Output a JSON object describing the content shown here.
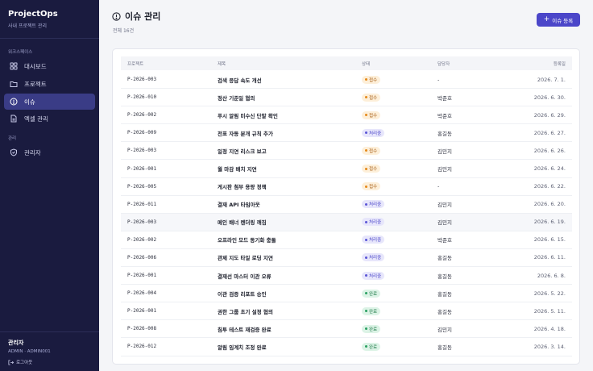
{
  "sidebar": {
    "brand": "ProjectOps",
    "brand_sub": "사내 프로젝트 관리",
    "workspace_label": "워크스페이스",
    "admin_label": "관리",
    "items": [
      {
        "label": "대시보드",
        "icon": "dashboard-icon"
      },
      {
        "label": "프로젝트",
        "icon": "folder-icon"
      },
      {
        "label": "이슈",
        "icon": "alert-circle-icon",
        "active": true
      },
      {
        "label": "엑셀 관리",
        "icon": "file-icon"
      },
      {
        "label": "관리자",
        "icon": "shield-icon"
      }
    ],
    "user": {
      "name": "관리자",
      "role": "ADMIN · ADMIN001",
      "logout": "로그아웃"
    }
  },
  "header": {
    "title": "이슈 관리",
    "count": "전체 16건",
    "add_button": "이슈 등록"
  },
  "table": {
    "columns": {
      "project": "프로젝트",
      "title": "제목",
      "status": "상태",
      "owner": "담당자",
      "date": "등록일"
    },
    "rows": [
      {
        "project": "P-2026-003",
        "title": "검색 응답 속도 개선",
        "status": "접수",
        "status_kind": "received",
        "owner": "-",
        "date": "2026. 7. 1."
      },
      {
        "project": "P-2026-010",
        "title": "정산 기준일 협의",
        "status": "접수",
        "status_kind": "received",
        "owner": "박준호",
        "date": "2026. 6. 30."
      },
      {
        "project": "P-2026-002",
        "title": "푸시 알림 미수신 단말 확인",
        "status": "접수",
        "status_kind": "received",
        "owner": "박준호",
        "date": "2026. 6. 29."
      },
      {
        "project": "P-2026-009",
        "title": "전표 자동 분개 규칙 추가",
        "status": "처리중",
        "status_kind": "progress",
        "owner": "홍길동",
        "date": "2026. 6. 27."
      },
      {
        "project": "P-2026-003",
        "title": "일정 지연 리스크 보고",
        "status": "접수",
        "status_kind": "received",
        "owner": "김민지",
        "date": "2026. 6. 26."
      },
      {
        "project": "P-2026-001",
        "title": "월 마감 배치 지연",
        "status": "접수",
        "status_kind": "received",
        "owner": "김민지",
        "date": "2026. 6. 24."
      },
      {
        "project": "P-2026-005",
        "title": "게시판 첨부 용량 정책",
        "status": "접수",
        "status_kind": "received",
        "owner": "-",
        "date": "2026. 6. 22."
      },
      {
        "project": "P-2026-011",
        "title": "결재 API 타임아웃",
        "status": "처리중",
        "status_kind": "progress",
        "owner": "김민지",
        "date": "2026. 6. 20."
      },
      {
        "project": "P-2026-003",
        "title": "메인 배너 렌더링 깨짐",
        "status": "처리중",
        "status_kind": "progress",
        "owner": "김민지",
        "date": "2026. 6. 19.",
        "hover": true
      },
      {
        "project": "P-2026-002",
        "title": "오프라인 모드 동기화 충돌",
        "status": "처리중",
        "status_kind": "progress",
        "owner": "박준호",
        "date": "2026. 6. 15."
      },
      {
        "project": "P-2026-006",
        "title": "관제 지도 타일 로딩 지연",
        "status": "처리중",
        "status_kind": "progress",
        "owner": "홍길동",
        "date": "2026. 6. 11."
      },
      {
        "project": "P-2026-001",
        "title": "결재선 마스터 이관 오류",
        "status": "처리중",
        "status_kind": "progress",
        "owner": "홍길동",
        "date": "2026. 6. 8."
      },
      {
        "project": "P-2026-004",
        "title": "이관 검증 리포트 승인",
        "status": "완료",
        "status_kind": "done",
        "owner": "홍길동",
        "date": "2026. 5. 22."
      },
      {
        "project": "P-2026-001",
        "title": "권한 그룹 초기 설정 협의",
        "status": "완료",
        "status_kind": "done",
        "owner": "홍길동",
        "date": "2026. 5. 11."
      },
      {
        "project": "P-2026-008",
        "title": "침투 테스트 재검증 완료",
        "status": "완료",
        "status_kind": "done",
        "owner": "김민지",
        "date": "2026. 4. 18."
      },
      {
        "project": "P-2026-012",
        "title": "알림 임계치 조정 완료",
        "status": "완료",
        "status_kind": "done",
        "owner": "홍길동",
        "date": "2026. 3. 14."
      }
    ]
  }
}
